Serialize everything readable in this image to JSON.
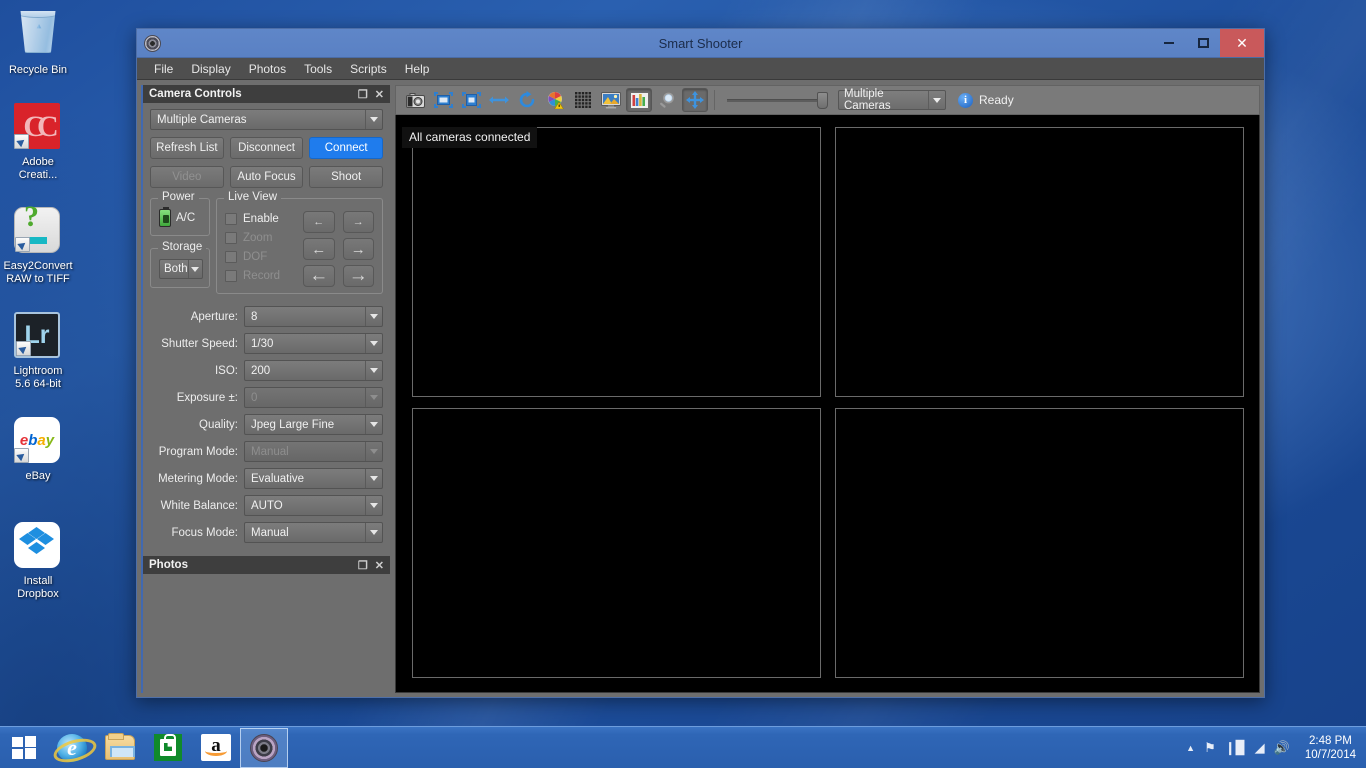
{
  "desktop": {
    "icons": [
      {
        "name": "Recycle Bin",
        "lines": [
          "Recycle Bin"
        ],
        "icon": "recycle-bin-icon"
      },
      {
        "name": "Adobe Creative Cloud",
        "lines": [
          "Adobe",
          "Creati..."
        ],
        "icon": "adobe-creative-cloud-icon"
      },
      {
        "name": "Easy2Convert RAW to TIFF",
        "lines": [
          "Easy2Convert",
          "RAW to TIFF"
        ],
        "icon": "easy2convert-icon"
      },
      {
        "name": "Lightroom 5.6 64-bit",
        "lines": [
          "Lightroom",
          "5.6 64-bit"
        ],
        "icon": "lightroom-icon"
      },
      {
        "name": "eBay",
        "lines": [
          "eBay"
        ],
        "icon": "ebay-icon"
      },
      {
        "name": "Install Dropbox",
        "lines": [
          "Install",
          "Dropbox"
        ],
        "icon": "dropbox-icon"
      }
    ]
  },
  "window": {
    "title": "Smart Shooter",
    "icon": "smart-shooter-icon",
    "controls": {
      "minimize": "–",
      "maximize": "□",
      "close": "✕"
    }
  },
  "menubar": {
    "items": [
      "File",
      "Display",
      "Photos",
      "Tools",
      "Scripts",
      "Help"
    ]
  },
  "camera_controls": {
    "panel_title": "Camera Controls",
    "panel_buttons": {
      "float": "❐",
      "close": "✕"
    },
    "camera_select": "Multiple Cameras",
    "buttons_row1": [
      {
        "label": "Refresh List",
        "state": "normal"
      },
      {
        "label": "Disconnect",
        "state": "normal"
      },
      {
        "label": "Connect",
        "state": "primary"
      }
    ],
    "buttons_row2": [
      {
        "label": "Video",
        "state": "disabled"
      },
      {
        "label": "Auto Focus",
        "state": "normal"
      },
      {
        "label": "Shoot",
        "state": "normal"
      }
    ],
    "power": {
      "legend": "Power",
      "value": "A/C",
      "icon": "battery-icon"
    },
    "storage": {
      "legend": "Storage",
      "value": "Both"
    },
    "live_view": {
      "legend": "Live View",
      "checks": [
        {
          "label": "Enable",
          "enabled": true
        },
        {
          "label": "Zoom",
          "enabled": false
        },
        {
          "label": "DOF",
          "enabled": false
        },
        {
          "label": "Record",
          "enabled": false
        }
      ],
      "arrows": [
        {
          "left": "←",
          "right": "→",
          "size": "s1"
        },
        {
          "left": "←",
          "right": "→",
          "size": "s2"
        },
        {
          "left": "←",
          "right": "→",
          "size": "s3"
        }
      ]
    },
    "settings": [
      {
        "label": "Aperture:",
        "value": "8",
        "disabled": false
      },
      {
        "label": "Shutter Speed:",
        "value": "1/30",
        "disabled": false
      },
      {
        "label": "ISO:",
        "value": "200",
        "disabled": false
      },
      {
        "label": "Exposure ±:",
        "value": "0",
        "disabled": true
      },
      {
        "label": "Quality:",
        "value": "Jpeg Large Fine",
        "disabled": false
      },
      {
        "label": "Program Mode:",
        "value": "Manual",
        "disabled": true
      },
      {
        "label": "Metering Mode:",
        "value": "Evaluative",
        "disabled": false
      },
      {
        "label": "White Balance:",
        "value": "AUTO",
        "disabled": false
      },
      {
        "label": "Focus Mode:",
        "value": "Manual",
        "disabled": false
      }
    ]
  },
  "photos_panel": {
    "panel_title": "Photos",
    "panel_buttons": {
      "float": "❐",
      "close": "✕"
    }
  },
  "toolbar": {
    "buttons": [
      {
        "name": "camera-icon",
        "pressed": false
      },
      {
        "name": "fit-image-icon",
        "pressed": false
      },
      {
        "name": "fit-width-icon",
        "pressed": false
      },
      {
        "name": "arrows-horizontal-icon",
        "pressed": false
      },
      {
        "name": "refresh-icon",
        "pressed": false
      },
      {
        "name": "color-wheel-icon",
        "pressed": false
      },
      {
        "name": "grid-icon",
        "pressed": false
      },
      {
        "name": "monitor-image-icon",
        "pressed": false
      },
      {
        "name": "histogram-icon",
        "pressed": true
      },
      {
        "name": "magnifier-icon",
        "pressed": false
      },
      {
        "name": "pan-move-icon",
        "pressed": true
      }
    ],
    "zoom_slider_value": 100,
    "camera_select": "Multiple Cameras",
    "status_icon": "info-icon",
    "status_text": "Ready"
  },
  "viewport": {
    "tooltip": "All cameras connected",
    "panes": [
      {
        "name": "camera-pane-1"
      },
      {
        "name": "camera-pane-2"
      },
      {
        "name": "camera-pane-3"
      },
      {
        "name": "camera-pane-4"
      }
    ]
  },
  "taskbar": {
    "start": "start-button",
    "items": [
      {
        "name": "internet-explorer-taskbar-icon",
        "active": false
      },
      {
        "name": "file-explorer-taskbar-icon",
        "active": false
      },
      {
        "name": "windows-store-taskbar-icon",
        "active": false
      },
      {
        "name": "amazon-taskbar-icon",
        "active": false
      },
      {
        "name": "smart-shooter-taskbar-icon",
        "active": true
      }
    ],
    "tray": [
      {
        "name": "show-hidden-icons",
        "glyph": "▲"
      },
      {
        "name": "action-flag-icon",
        "glyph": "⚑"
      },
      {
        "name": "battery-icon",
        "glyph": "❙▉"
      },
      {
        "name": "network-icon",
        "glyph": "◢"
      },
      {
        "name": "volume-icon",
        "glyph": "🔊"
      }
    ],
    "clock": {
      "time": "2:48 PM",
      "date": "10/7/2014"
    }
  },
  "colors": {
    "accent_blue": "#1f7ced",
    "panel_gray": "#6e6e6e",
    "titlebar_blue": "#5f86c8",
    "close_red": "#c9595b",
    "viewport_black": "#000000"
  }
}
